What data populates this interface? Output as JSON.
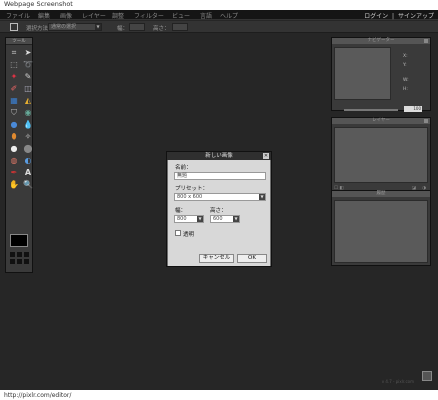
{
  "page": {
    "caption": "Webpage Screenshot",
    "url": "http://pixlr.com/editor/"
  },
  "menu": {
    "items": [
      "ファイル",
      "編集",
      "画像",
      "レイヤー",
      "調整",
      "フィルター",
      "ビュー",
      "言語",
      "ヘルプ"
    ],
    "login": "ログイン",
    "separator": "|",
    "signup": "サインアップ"
  },
  "options": {
    "selection_label": "選択方法",
    "selection_value": "通常の選択",
    "width_label": "幅：",
    "height_label": "高さ："
  },
  "toolbox": {
    "title": "ツール"
  },
  "panels": {
    "navigator": {
      "title": "ナビゲーター",
      "x_label": "X:",
      "y_label": "Y:",
      "w_label": "W:",
      "h_label": "H:",
      "zoom": "100"
    },
    "layers": {
      "title": "レイヤー"
    },
    "history": {
      "title": "履歴"
    }
  },
  "dialog": {
    "title": "新しい画像",
    "close_icon": "close-icon",
    "name_label": "名前：",
    "name_value": "無題",
    "preset_label": "プリセット：",
    "preset_value": "800 x 600",
    "width_label": "幅：",
    "width_value": "800",
    "height_label": "高さ：",
    "height_value": "600",
    "transparent_label": "透明",
    "cancel_label": "キャンセル",
    "ok_label": "OK"
  },
  "status": {
    "text": "v 4.7 - pixlr.com"
  },
  "colors": {
    "app_bg": "#262626",
    "menu_bg": "#151515",
    "dialog_body": "#d8d8d8",
    "swatch": "#000000"
  }
}
